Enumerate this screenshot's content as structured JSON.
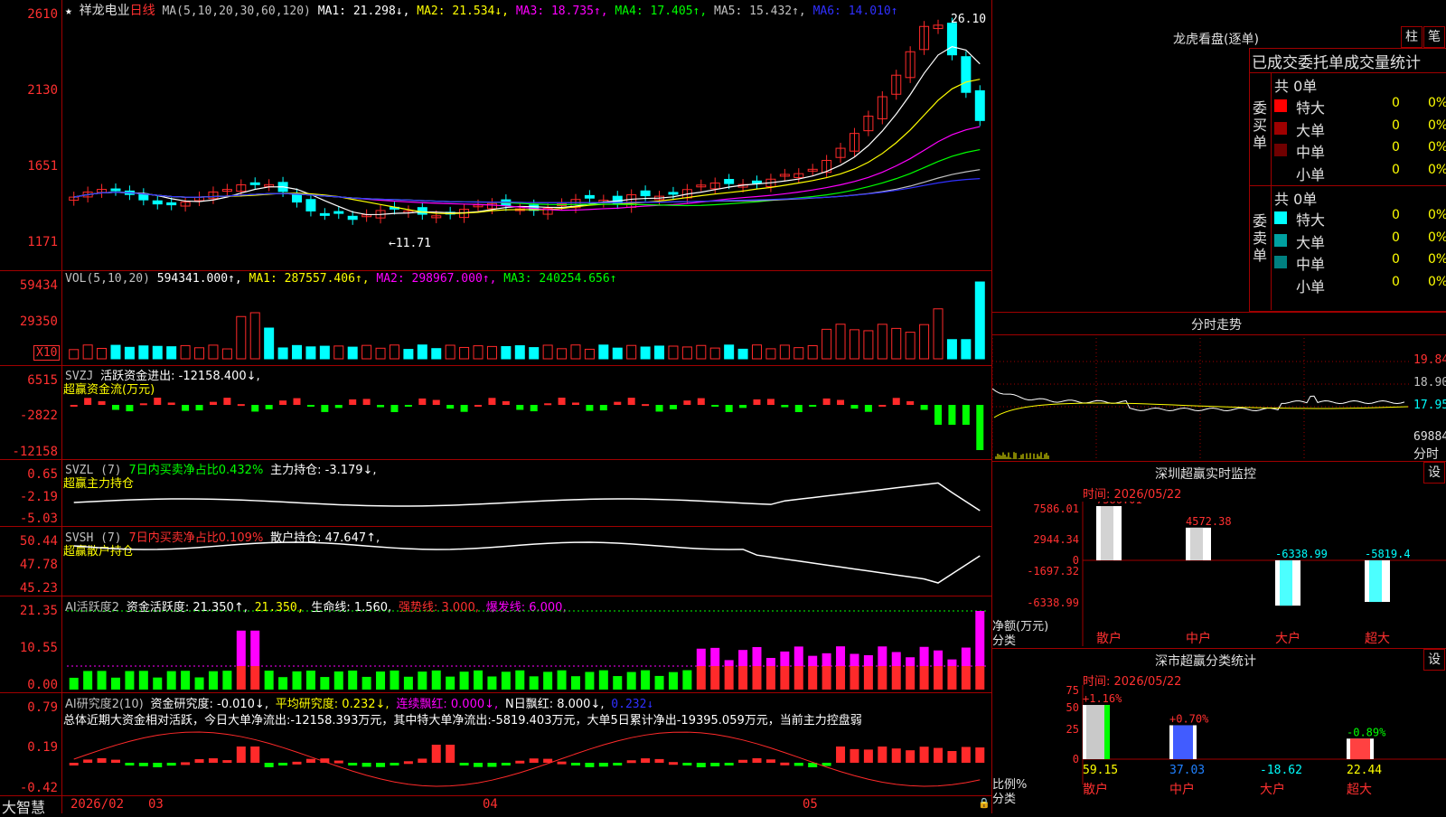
{
  "app": {
    "name": "大智慧"
  },
  "colors": {
    "up": "#ff2a2a",
    "down": "#00ffff",
    "green": "#00ff00",
    "yellow": "#ffff00",
    "magenta": "#ff00ff",
    "grid": "#a00000",
    "white": "#ffffff"
  },
  "kline": {
    "stock_name": "祥龙电业",
    "period": "日线",
    "ma_params": "MA(5,10,20,30,60,120)",
    "ma1": "MA1: 21.298↓,",
    "ma2": "MA2: 21.534↓,",
    "ma3": "MA3: 18.735↑,",
    "ma4": "MA4: 17.405↑,",
    "ma5": "MA5: 15.432↑,",
    "ma6": "MA6: 14.010↑",
    "y_ticks": [
      "2610",
      "2130",
      "1651",
      "1171"
    ],
    "high_mark": "26.10",
    "low_mark": "←11.71"
  },
  "volume": {
    "params": "VOL(5,10,20)",
    "value": "594341.000↑,",
    "ma1": "MA1: 287557.406↑,",
    "ma2": "MA2: 298967.000↑,",
    "ma3": "MA3: 240254.656↑",
    "y_ticks": [
      "59434",
      "29350"
    ],
    "unit": "X10"
  },
  "svzj": {
    "name": "SVZJ",
    "label": "活跃资金进出: -12158.400↓,",
    "sub": "超赢资金流(万元)",
    "y_ticks": [
      "6515",
      "-2822",
      "-12158"
    ]
  },
  "svzl": {
    "name": "SVZL (7)",
    "pct": "7日内买卖净占比0.432%",
    "hold": "主力持仓: -3.179↓,",
    "sub": "超赢主力持仓",
    "y_ticks": [
      "0.65",
      "-2.19",
      "-5.03"
    ]
  },
  "svsh": {
    "name": "SVSH (7)",
    "pct": "7日内买卖净占比0.109%",
    "hold": "散户持仓: 47.647↑,",
    "sub": "超赢散户持仓",
    "y_ticks": [
      "50.44",
      "47.78",
      "45.23"
    ]
  },
  "ai1": {
    "name": "AI活跃度2",
    "label": "资金活跃度: 21.350↑,",
    "v2": "21.350,",
    "life": "生命线: 1.560,",
    "strong": "强势线: 3.000,",
    "burst": "爆发线: 6.000,",
    "y_ticks": [
      "21.35",
      "10.55",
      "0.00"
    ]
  },
  "ai2": {
    "name": "AI研究度2(10)",
    "label": "资金研究度: -0.010↓,",
    "avg": "平均研究度: 0.232↓,",
    "cont": "连续飘红: 0.000↓,",
    "nday": "N日飘红: 8.000↓,",
    "v": "0.232↓",
    "summary": "总体近期大资金相对活跃，今日大单净流出:-12158.393万元，其中特大单净流出:-5819.403万元，大单5日累计净出-19395.059万元，当前主力控盘弱",
    "y_ticks": [
      "0.79",
      "0.19",
      "-0.42"
    ]
  },
  "time_axis": {
    "labels": [
      "2026/02",
      "03",
      "04",
      "05"
    ]
  },
  "right": {
    "dragon": {
      "title": "龙虎看盘(逐单)",
      "btn1": "柱",
      "btn2": "笔",
      "header": "已成交委托单成交量统计",
      "buy_total": "共 0单",
      "buy_label": "委买单",
      "sell_total": "共 0单",
      "sell_label": "委卖单",
      "buy_rows": [
        {
          "name": "特大",
          "count": "0",
          "pct": "0%",
          "color": "#ff0000"
        },
        {
          "name": "大单",
          "count": "0",
          "pct": "0%",
          "color": "#a00000"
        },
        {
          "name": "中单",
          "count": "0",
          "pct": "0%",
          "color": "#700000"
        },
        {
          "name": "小单",
          "count": "0",
          "pct": "0%",
          "color": ""
        }
      ],
      "sell_rows": [
        {
          "name": "特大",
          "count": "0",
          "pct": "0%",
          "color": "#00ffff"
        },
        {
          "name": "大单",
          "count": "0",
          "pct": "0%",
          "color": "#00a0a0"
        },
        {
          "name": "中单",
          "count": "0",
          "pct": "0%",
          "color": "#008080"
        },
        {
          "name": "小单",
          "count": "0",
          "pct": "0%",
          "color": ""
        }
      ]
    },
    "intraday": {
      "title": "分时走势",
      "ticks": [
        "19.84",
        "18.90",
        "17.95",
        "69884"
      ],
      "bottom": "分时"
    },
    "sz_monitor": {
      "title": "深圳超赢实时监控",
      "btn": "设",
      "time": "时间: 2026/05/22",
      "y_ticks": [
        "7586.01",
        "2944.34",
        "0",
        "-1697.32",
        "-6338.99"
      ],
      "ylabel": "净额(万元)",
      "xlabel": "分类",
      "categories": [
        "散户",
        "中户",
        "大户",
        "超大"
      ],
      "values_text": [
        "7586.01",
        "4572.38",
        "-6338.99",
        "-5819.4"
      ]
    },
    "sz_category": {
      "title": "深市超赢分类统计",
      "btn": "设",
      "time": "时间: 2026/05/22",
      "y_ticks": [
        "75",
        "50",
        "25",
        "0"
      ],
      "ylabel": "比例%",
      "xlabel": "分类",
      "categories": [
        "散户",
        "中户",
        "大户",
        "超大"
      ],
      "change_text": [
        "+1.16%",
        "+0.70%",
        "",
        "-0.89%"
      ],
      "values_text": [
        "59.15",
        "37.03",
        "-18.62",
        "22.44"
      ]
    }
  },
  "chart_data": [
    {
      "type": "bar",
      "title": "深圳超赢实时监控",
      "ylabel": "净额(万元)",
      "xlabel": "分类",
      "categories": [
        "散户",
        "中户",
        "大户",
        "超大"
      ],
      "values": [
        7586.01,
        4572.38,
        -6338.99,
        -5819.4
      ],
      "ylim": [
        -6338.99,
        7586.01
      ]
    },
    {
      "type": "bar",
      "title": "深市超赢分类统计",
      "ylabel": "比例%",
      "xlabel": "分类",
      "categories": [
        "散户",
        "中户",
        "大户",
        "超大"
      ],
      "values": [
        59.15,
        37.03,
        -18.62,
        22.44
      ],
      "ylim": [
        0,
        75
      ]
    }
  ]
}
